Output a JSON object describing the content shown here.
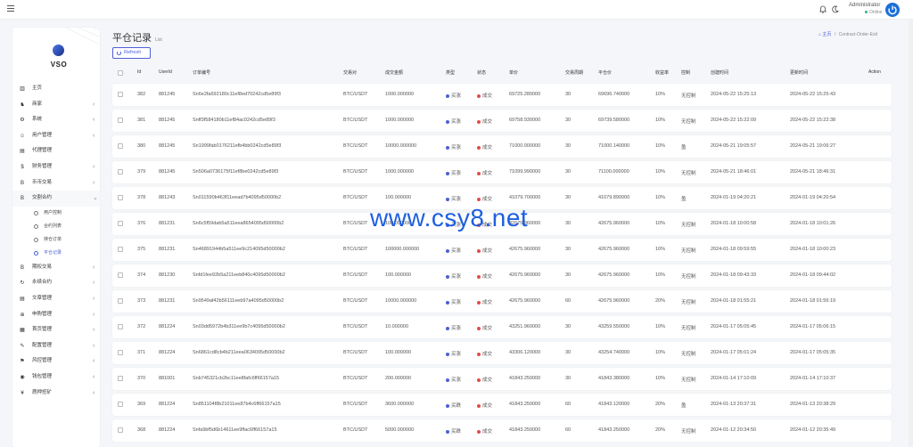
{
  "header": {
    "admin_name": "Administrator",
    "admin_status": "Online"
  },
  "sidebar": {
    "logo_text": "VSO",
    "items": [
      {
        "label": "主页",
        "icon": "▥",
        "chev": false
      },
      {
        "label": "商家",
        "icon": "♞",
        "chev": true
      },
      {
        "label": "系统",
        "icon": "⚙",
        "chev": true
      },
      {
        "label": "用户管理",
        "icon": "☺",
        "chev": true
      },
      {
        "label": "代理管理",
        "icon": "▤",
        "chev": false
      },
      {
        "label": "财务管理",
        "icon": "$",
        "chev": true
      },
      {
        "label": "币币交易",
        "icon": "B",
        "chev": true
      },
      {
        "label": "交割合约",
        "icon": "B",
        "chev": true,
        "open": true
      }
    ],
    "subitems": [
      {
        "label": "用户控制"
      },
      {
        "label": "合约列表"
      },
      {
        "label": "持仓订单"
      },
      {
        "label": "平仓记录",
        "current": true
      }
    ],
    "items2": [
      {
        "label": "期权交易",
        "icon": "B",
        "chev": true
      },
      {
        "label": "永续合约",
        "icon": "↻",
        "chev": true
      },
      {
        "label": "文章管理",
        "icon": "▤",
        "chev": true
      },
      {
        "label": "申购管理",
        "icon": "⊕",
        "chev": true
      },
      {
        "label": "首页管理",
        "icon": "▦",
        "chev": true
      },
      {
        "label": "配置管理",
        "icon": "✎",
        "chev": true
      },
      {
        "label": "风控管理",
        "icon": "⚑",
        "chev": true
      },
      {
        "label": "钱包管理",
        "icon": "◉",
        "chev": true
      },
      {
        "label": "质押挖矿",
        "icon": "¥",
        "chev": true
      }
    ]
  },
  "page": {
    "title": "平仓记录",
    "subtitle": "List",
    "breadcrumb_home": "主页",
    "breadcrumb_sep": "/",
    "breadcrumb_current": "Contract-Order-Exit",
    "refresh_label": "Refresh"
  },
  "table": {
    "columns": [
      "Id",
      "UserId",
      "订单编号",
      "交易对",
      "成交金额",
      "类型",
      "状态",
      "单价",
      "交易周期",
      "平仓价",
      "收益率",
      "控制",
      "创建时间",
      "更新时间",
      "Action"
    ],
    "rows": [
      [
        "382",
        "881245",
        "Sn6e2fa692180c11ef8ed70242cd5e89f3",
        "BTC/USDT",
        "1000.000000",
        "买涨",
        "成交",
        "69725.280000",
        "30",
        "69696.740000",
        "10%",
        "无控制",
        "2024-05-22 15:25:13",
        "2024-05-22 15:25:43"
      ],
      [
        "381",
        "881245",
        "Snff3f584180b11ef84ac0242cd5e89f3",
        "BTC/USDT",
        "1000.000000",
        "买涨",
        "成交",
        "69758.930000",
        "30",
        "69739.580000",
        "10%",
        "无控制",
        "2024-05-22 15:22:09",
        "2024-05-22 15:22:38"
      ],
      [
        "380",
        "881245",
        "Sn1999fab0176211efb4bb0242cd5e89f3",
        "BTC/USDT",
        "10000.000000",
        "买涨",
        "成交",
        "71000.000000",
        "30",
        "71000.140000",
        "10%",
        "盈",
        "2024-05-21 19:05:57",
        "2024-05-21 19:06:27"
      ],
      [
        "379",
        "881245",
        "Sn506a0736175f11ef8be0242cd5e89f3",
        "BTC/USDT",
        "1000.000000",
        "买涨",
        "成交",
        "71099.990000",
        "30",
        "71100.000000",
        "10%",
        "无控制",
        "2024-05-21 18:46:01",
        "2024-05-21 18:46:31"
      ],
      [
        "378",
        "881243",
        "Sn011590b463f11eead7b4095d50000b2",
        "BTC/USDT",
        "100.000000",
        "买涨",
        "成交",
        "41079.700000",
        "30",
        "41079.890000",
        "10%",
        "盈",
        "2024-01-19 04:20:21",
        "2024-01-19 04:20:54"
      ],
      [
        "376",
        "881231",
        "Sn6c5f59dab5a511eea8654095d50000b2",
        "BTC/USDT",
        "100.000000",
        "买涨",
        "成交",
        "42675.960000",
        "30",
        "42675.960000",
        "10%",
        "无控制",
        "2024-01-18 10:00:58",
        "2024-01-18 10:01:26"
      ],
      [
        "375",
        "881231",
        "Sn46891944b5a511ee9c214095d50000b2",
        "BTC/USDT",
        "100000.000000",
        "买涨",
        "成交",
        "42675.960000",
        "30",
        "42675.960000",
        "10%",
        "无控制",
        "2024-01-18 09:59:55",
        "2024-01-18 10:00:23"
      ],
      [
        "374",
        "881230",
        "Snfd1fee92b5a211eeb840c4095d50000b2",
        "BTC/USDT",
        "100.000000",
        "买涨",
        "成交",
        "42675.960000",
        "30",
        "42675.960000",
        "10%",
        "无控制",
        "2024-01-18 09:43:33",
        "2024-01-18 09:44:02"
      ],
      [
        "373",
        "881231",
        "Sn9549af42b56111eeb97a4095d50000b2",
        "BTC/USDT",
        "10000.000000",
        "买涨",
        "成交",
        "42675.960000",
        "60",
        "42675.960000",
        "20%",
        "无控制",
        "2024-01-18 01:55:21",
        "2024-01-18 01:56:19"
      ],
      [
        "372",
        "881224",
        "Sn03dd5972b4b311ee9b7c4095d50000b2",
        "BTC/USDT",
        "10.000000",
        "买涨",
        "成交",
        "43251.960000",
        "30",
        "43259.550000",
        "10%",
        "无控制",
        "2024-01-17 05:05:45",
        "2024-01-17 05:06:15"
      ],
      [
        "371",
        "881224",
        "Sn6861cd8cb4b211eea0634095d50000b2",
        "BTC/USDT",
        "100.000000",
        "买涨",
        "成交",
        "43306.120000",
        "30",
        "43254.740000",
        "10%",
        "无控制",
        "2024-01-17 05:01:24",
        "2024-01-17 05:05:35"
      ],
      [
        "370",
        "881001",
        "Snb745321cb2bc11ee8fafc6ff66157a15",
        "BTC/USDT",
        "200.000000",
        "买涨",
        "成交",
        "41843.250000",
        "30",
        "41843.380000",
        "10%",
        "无控制",
        "2024-01-14 17:10:09",
        "2024-01-14 17:10:37"
      ],
      [
        "369",
        "881224",
        "Sn851104f8b21011ee87b4c6ff66157a15",
        "BTC/USDT",
        "3600.000000",
        "买跌",
        "成交",
        "41843.250000",
        "60",
        "41843.120000",
        "20%",
        "盈",
        "2024-01-13 20:37:31",
        "2024-01-13 20:38:29"
      ],
      [
        "368",
        "881224",
        "Snfa9bf5d6b14611ee9ffac6ff66157a15",
        "BTC/USDT",
        "5000.000000",
        "买跌",
        "成交",
        "41843.250000",
        "60",
        "41843.250000",
        "20%",
        "无控制",
        "2024-01-12 20:34:50",
        "2024-01-12 20:35:49"
      ]
    ]
  },
  "watermark": "www.csy8.net",
  "colors": {
    "accent": "#4c5fd6",
    "success": "#28b779",
    "status_red": "#e34b4b",
    "brand_blue": "#1c6fd8"
  }
}
